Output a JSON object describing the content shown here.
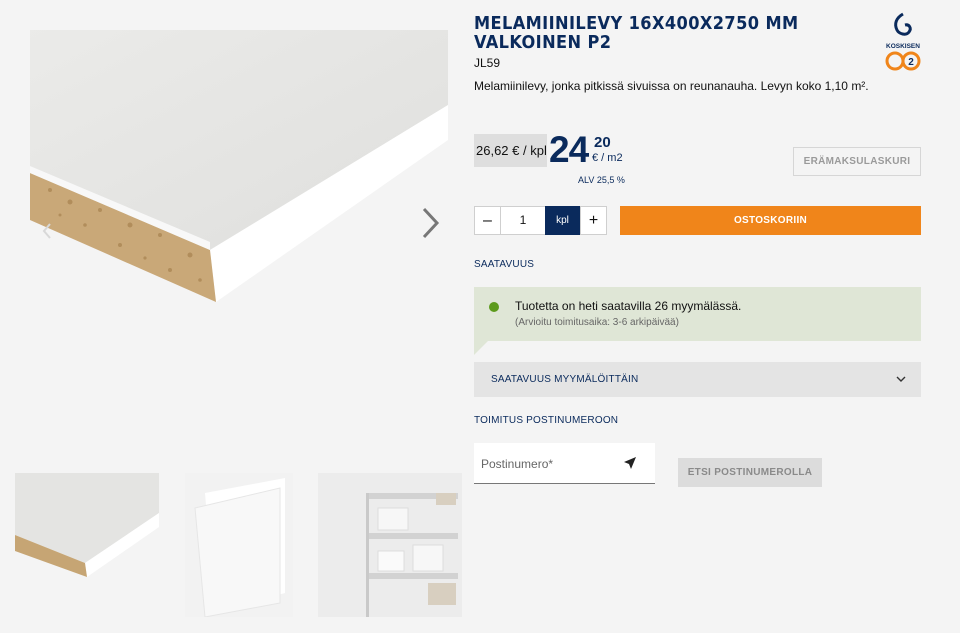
{
  "product": {
    "title": "MELAMIINILEVY 16X400X2750 MM VALKOINEN P2",
    "sku": "JL59",
    "description": "Melamiinilevy, jonka pitkissä sivuissa on reunanauha. Levyn koko 1,10 m²."
  },
  "brand": {
    "logo_text": "KOSKISEN",
    "logo_badge": "2"
  },
  "price": {
    "old": "26,62 € / kpl",
    "integer": "24",
    "decimals": "20",
    "unit": "€ / m2",
    "vat": "ALV 25,5 %"
  },
  "calculator": {
    "label": "ERÄMAKSULASKURI"
  },
  "quantity": {
    "minus": "–",
    "value": "1",
    "unit": "kpl",
    "plus": "+"
  },
  "cart": {
    "label": "OSTOSKORIIN"
  },
  "availability": {
    "section_label": "SAATAVUUS",
    "status": "Tuotetta on heti saatavilla 26 myymälässä.",
    "delivery": "(Arvioitu toimitusaika: 3-6 arkipäivää)",
    "stores_label": "SAATAVUUS MYYMÄLÖITTÄIN"
  },
  "delivery": {
    "section_label": "TOIMITUS POSTINUMEROON",
    "postal_placeholder": "Postinumero*",
    "search_label": "ETSI POSTINUMEROLLA"
  },
  "icons": {
    "next": "chevron-right-icon",
    "accordion": "chevron-down-icon",
    "locate": "location-arrow-icon"
  },
  "colors": {
    "brand_navy": "#0a2a5c",
    "cart_orange": "#f0851a",
    "availability_green": "#5c9a1c",
    "availability_bg": "#dfe6d6"
  }
}
